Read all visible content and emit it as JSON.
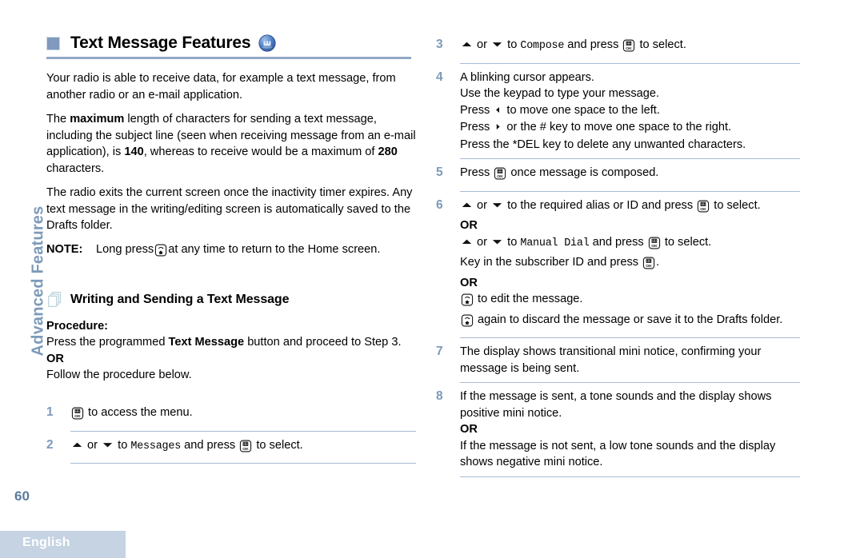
{
  "chapter_tab": {
    "label": "Advanced Features"
  },
  "footer": {
    "page_number": "60",
    "language": "English"
  },
  "header": {
    "title": "Text Message Features",
    "bullet_icon": "square-bullet-icon",
    "badge_icon": "digital-mode-badge-icon"
  },
  "left_column": {
    "paragraph_1": "Your radio is able to receive data, for example a text message, from another radio or an e-mail application.",
    "paragraph_2": {
      "part_1": "The ",
      "bold_1": "maximum",
      "part_2": " length of characters for sending a text message, including the subject line (seen when receiving message from an e-mail application), is ",
      "bold_2": "140",
      "part_3": ", whereas to receive would be a maximum of ",
      "bold_3": "280",
      "part_4": " characters."
    },
    "paragraph_3": "The radio exits the current screen once the inactivity timer expires. Any text message in the writing/editing screen is automatically saved to the Drafts folder.",
    "note": {
      "label": "NOTE:",
      "text_before": "Long press",
      "key_icon": "back-home-key-icon",
      "text_after": "at any time to return to the Home screen."
    },
    "subheading": {
      "icon": "pages-stack-icon",
      "text": "Writing and Sending a Text Message"
    },
    "procedure_label": "Procedure:",
    "intro": {
      "line_1_part_1": "Press the programmed ",
      "line_1_bold": "Text Message",
      "line_1_part_2": " button and proceed to Step 3.",
      "or": "OR",
      "line_2": "Follow the procedure below."
    },
    "steps": [
      {
        "number": "1",
        "lines": [
          {
            "segments": [
              {
                "type": "key",
                "icon": "ok-menu-key-icon"
              },
              {
                "type": "text",
                "text": " to access the menu."
              }
            ]
          }
        ]
      },
      {
        "number": "2",
        "lines": [
          {
            "segments": [
              {
                "type": "tri",
                "icon": "arrow-up-icon"
              },
              {
                "type": "text",
                "text": " or "
              },
              {
                "type": "tri",
                "icon": "arrow-down-icon"
              },
              {
                "type": "text",
                "text": " to "
              },
              {
                "type": "mono",
                "text": "Messages"
              },
              {
                "type": "text",
                "text": " and press "
              },
              {
                "type": "key",
                "icon": "ok-menu-key-icon"
              },
              {
                "type": "text",
                "text": " to select."
              }
            ]
          }
        ]
      }
    ]
  },
  "right_column": {
    "steps": [
      {
        "number": "3",
        "lines": [
          {
            "segments": [
              {
                "type": "tri",
                "icon": "arrow-up-icon"
              },
              {
                "type": "text",
                "text": " or "
              },
              {
                "type": "tri",
                "icon": "arrow-down-icon"
              },
              {
                "type": "text",
                "text": " to "
              },
              {
                "type": "mono",
                "text": "Compose"
              },
              {
                "type": "text",
                "text": " and press "
              },
              {
                "type": "key",
                "icon": "ok-menu-key-icon"
              },
              {
                "type": "text",
                "text": " to select."
              }
            ]
          }
        ]
      },
      {
        "number": "4",
        "lines": [
          {
            "segments": [
              {
                "type": "text",
                "text": "A blinking cursor appears."
              }
            ]
          },
          {
            "segments": [
              {
                "type": "text",
                "text": "Use the keypad to type your message."
              }
            ]
          },
          {
            "segments": [
              {
                "type": "text",
                "text": "Press "
              },
              {
                "type": "tri",
                "icon": "arrow-left-icon"
              },
              {
                "type": "text",
                "text": " to move one space to the left."
              }
            ]
          },
          {
            "segments": [
              {
                "type": "text",
                "text": "Press "
              },
              {
                "type": "tri",
                "icon": "arrow-right-icon"
              },
              {
                "type": "text",
                "text": " or the # key to move one space to the right."
              }
            ]
          },
          {
            "segments": [
              {
                "type": "text",
                "text": "Press the *DEL key to delete any unwanted characters."
              }
            ]
          }
        ]
      },
      {
        "number": "5",
        "lines": [
          {
            "segments": [
              {
                "type": "text",
                "text": "Press "
              },
              {
                "type": "key",
                "icon": "ok-menu-key-icon"
              },
              {
                "type": "text",
                "text": " once message is composed."
              }
            ]
          }
        ]
      },
      {
        "number": "6",
        "lines": [
          {
            "segments": [
              {
                "type": "tri",
                "icon": "arrow-up-icon"
              },
              {
                "type": "text",
                "text": " or "
              },
              {
                "type": "tri",
                "icon": "arrow-down-icon"
              },
              {
                "type": "text",
                "text": " to the required alias or ID and press "
              },
              {
                "type": "key",
                "icon": "ok-menu-key-icon"
              },
              {
                "type": "text",
                "text": " to select."
              }
            ]
          },
          {
            "segments": [
              {
                "type": "or",
                "text": "OR"
              }
            ]
          },
          {
            "segments": [
              {
                "type": "tri",
                "icon": "arrow-up-icon"
              },
              {
                "type": "text",
                "text": " or "
              },
              {
                "type": "tri",
                "icon": "arrow-down-icon"
              },
              {
                "type": "text",
                "text": " to "
              },
              {
                "type": "mono",
                "text": "Manual Dial"
              },
              {
                "type": "text",
                "text": " and press "
              },
              {
                "type": "key",
                "icon": "ok-menu-key-icon"
              },
              {
                "type": "text",
                "text": " to select."
              }
            ]
          },
          {
            "segments": [
              {
                "type": "text",
                "text": "Key in the subscriber ID and press "
              },
              {
                "type": "key",
                "icon": "ok-menu-key-icon"
              },
              {
                "type": "text",
                "text": "."
              }
            ]
          },
          {
            "segments": [
              {
                "type": "or",
                "text": "OR"
              }
            ]
          },
          {
            "segments": [
              {
                "type": "key",
                "icon": "back-home-key-icon"
              },
              {
                "type": "text",
                "text": " to edit the message."
              }
            ]
          },
          {
            "segments": [
              {
                "type": "key",
                "icon": "back-home-key-icon"
              },
              {
                "type": "text",
                "text": " again to discard the message or save it to the Drafts folder."
              }
            ]
          }
        ]
      },
      {
        "number": "7",
        "lines": [
          {
            "segments": [
              {
                "type": "text",
                "text": "The display shows transitional mini notice, confirming your message is being sent."
              }
            ]
          }
        ]
      },
      {
        "number": "8",
        "lines": [
          {
            "segments": [
              {
                "type": "text",
                "text": "If the message is sent, a tone sounds and the display shows positive mini notice."
              }
            ]
          },
          {
            "segments": [
              {
                "type": "or",
                "text": "OR"
              }
            ]
          },
          {
            "segments": [
              {
                "type": "text",
                "text": "If the message is not sent, a low tone sounds and the display shows negative mini notice."
              }
            ]
          }
        ]
      }
    ]
  },
  "colors": {
    "accent_blue": "#7d9ab9",
    "rule_blue": "#92a9c7",
    "separator_blue": "#a7bcd4",
    "footer_bar": "#c5d3e2"
  }
}
